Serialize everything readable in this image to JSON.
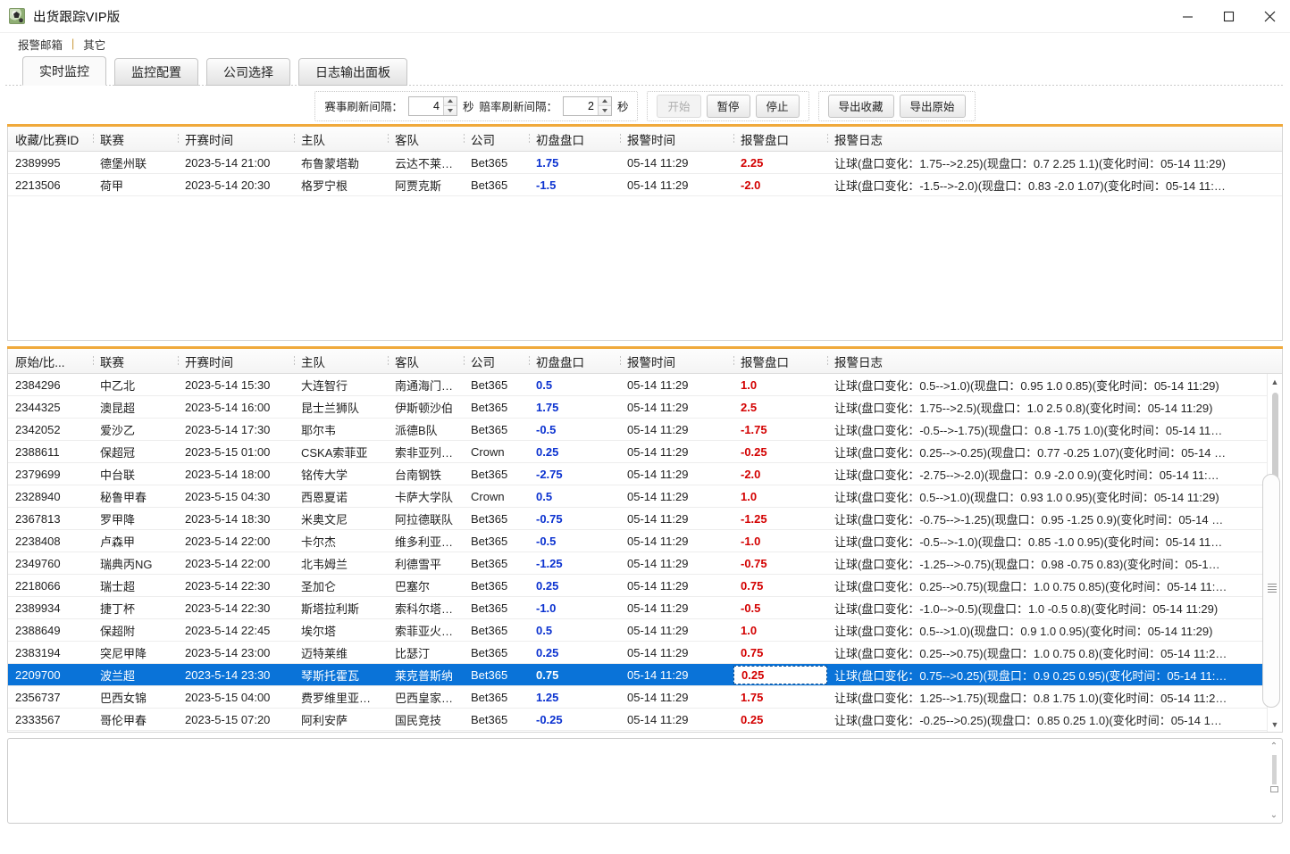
{
  "window": {
    "title": "出货跟踪VIP版",
    "icon": "soccer-ball-icon",
    "minimize": "−",
    "maximize": "□",
    "close": "✕"
  },
  "menubar": {
    "items": [
      "报警邮箱",
      "其它"
    ],
    "separator": "|"
  },
  "tabs": [
    {
      "label": "实时监控",
      "active": true
    },
    {
      "label": "监控配置",
      "active": false
    },
    {
      "label": "公司选择",
      "active": false
    },
    {
      "label": "日志输出面板",
      "active": false
    }
  ],
  "toolbar": {
    "match_interval_label": "赛事刷新间隔：",
    "match_interval_value": "4",
    "match_interval_unit": "秒",
    "odds_interval_label": "赔率刷新间隔：",
    "odds_interval_value": "2",
    "odds_interval_unit": "秒",
    "start_label": "开始",
    "start_disabled": true,
    "pause_label": "暂停",
    "stop_label": "停止",
    "export_fav_label": "导出收藏",
    "export_raw_label": "导出原始"
  },
  "accent_color": "#f0a93b",
  "top_grid": {
    "columns": [
      "收藏/比赛ID",
      "联赛",
      "开赛时间",
      "主队",
      "客队",
      "公司",
      "初盘盘口",
      "报警时间",
      "报警盘口",
      "报警日志"
    ],
    "rows": [
      {
        "id": "2389995",
        "league": "德堡州联",
        "start": "2023-5-14 21:00",
        "home": "布鲁蒙塔勒",
        "away": "云达不莱梅C队",
        "company": "Bet365",
        "open": "1.75",
        "alert_time": "05-14 11:29",
        "alert_odds": "2.25",
        "log": "让球(盘口变化：1.75-->2.25)(现盘口：0.7  2.25  1.1)(变化时间：05-14 11:29)"
      },
      {
        "id": "2213506",
        "league": "荷甲",
        "start": "2023-5-14 20:30",
        "home": "格罗宁根",
        "away": "阿贾克斯",
        "company": "Bet365",
        "open": "-1.5",
        "alert_time": "05-14 11:29",
        "alert_odds": "-2.0",
        "log": "让球(盘口变化：-1.5-->-2.0)(现盘口：0.83  -2.0  1.07)(变化时间：05-14 11:…"
      }
    ]
  },
  "bottom_grid": {
    "columns": [
      "原始/比...",
      "联赛",
      "开赛时间",
      "主队",
      "客队",
      "公司",
      "初盘盘口",
      "报警时间",
      "报警盘口",
      "报警日志"
    ],
    "rows": [
      {
        "id": "2384296",
        "league": "中乙北",
        "start": "2023-5-14 15:30",
        "home": "大连智行",
        "away": "南通海门圳缔…",
        "company": "Bet365",
        "open": "0.5",
        "alert_time": "05-14 11:29",
        "alert_odds": "1.0",
        "log": "让球(盘口变化：0.5-->1.0)(现盘口：0.95  1.0  0.85)(变化时间：05-14 11:29)",
        "selected": false
      },
      {
        "id": "2344325",
        "league": "澳昆超",
        "start": "2023-5-14 16:00",
        "home": "昆士兰狮队",
        "away": "伊斯顿沙伯",
        "company": "Bet365",
        "open": "1.75",
        "alert_time": "05-14 11:29",
        "alert_odds": "2.5",
        "log": "让球(盘口变化：1.75-->2.5)(现盘口：1.0  2.5  0.8)(变化时间：05-14 11:29)",
        "selected": false
      },
      {
        "id": "2342052",
        "league": "爱沙乙",
        "start": "2023-5-14 17:30",
        "home": "耶尔韦",
        "away": "派德B队",
        "company": "Bet365",
        "open": "-0.5",
        "alert_time": "05-14 11:29",
        "alert_odds": "-1.75",
        "log": "让球(盘口变化：-0.5-->-1.75)(现盘口：0.8  -1.75  1.0)(变化时间：05-14 11…",
        "selected": false
      },
      {
        "id": "2388611",
        "league": "保超冠",
        "start": "2023-5-15 01:00",
        "home": "CSKA索菲亚",
        "away": "索非亚列夫斯…",
        "company": "Crown",
        "open": "0.25",
        "alert_time": "05-14 11:29",
        "alert_odds": "-0.25",
        "log": "让球(盘口变化：0.25-->-0.25)(现盘口：0.77  -0.25  1.07)(变化时间：05-14 …",
        "selected": false
      },
      {
        "id": "2379699",
        "league": "中台联",
        "start": "2023-5-14 18:00",
        "home": "铭传大学",
        "away": "台南钢铁",
        "company": "Bet365",
        "open": "-2.75",
        "alert_time": "05-14 11:29",
        "alert_odds": "-2.0",
        "log": "让球(盘口变化：-2.75-->-2.0)(现盘口：0.9  -2.0  0.9)(变化时间：05-14 11:…",
        "selected": false
      },
      {
        "id": "2328940",
        "league": "秘鲁甲春",
        "start": "2023-5-15 04:30",
        "home": "西恩夏诺",
        "away": "卡萨大学队",
        "company": "Crown",
        "open": "0.5",
        "alert_time": "05-14 11:29",
        "alert_odds": "1.0",
        "log": "让球(盘口变化：0.5-->1.0)(现盘口：0.93  1.0  0.95)(变化时间：05-14 11:29)",
        "selected": false
      },
      {
        "id": "2367813",
        "league": "罗甲降",
        "start": "2023-5-14 18:30",
        "home": "米奥文尼",
        "away": "阿拉德联队",
        "company": "Bet365",
        "open": "-0.75",
        "alert_time": "05-14 11:29",
        "alert_odds": "-1.25",
        "log": "让球(盘口变化：-0.75-->-1.25)(现盘口：0.95  -1.25  0.9)(变化时间：05-14 …",
        "selected": false
      },
      {
        "id": "2238408",
        "league": "卢森甲",
        "start": "2023-5-14 22:00",
        "home": "卡尔杰",
        "away": "维多利亚路斯…",
        "company": "Bet365",
        "open": "-0.5",
        "alert_time": "05-14 11:29",
        "alert_odds": "-1.0",
        "log": "让球(盘口变化：-0.5-->-1.0)(现盘口：0.85  -1.0  0.95)(变化时间：05-14 11…",
        "selected": false
      },
      {
        "id": "2349760",
        "league": "瑞典丙NG",
        "start": "2023-5-14 22:00",
        "home": "北韦姆兰",
        "away": "利德雪平",
        "company": "Bet365",
        "open": "-1.25",
        "alert_time": "05-14 11:29",
        "alert_odds": "-0.75",
        "log": "让球(盘口变化：-1.25-->-0.75)(现盘口：0.98  -0.75  0.83)(变化时间：05-1…",
        "selected": false
      },
      {
        "id": "2218066",
        "league": "瑞士超",
        "start": "2023-5-14 22:30",
        "home": "圣加仑",
        "away": "巴塞尔",
        "company": "Bet365",
        "open": "0.25",
        "alert_time": "05-14 11:29",
        "alert_odds": "0.75",
        "log": "让球(盘口变化：0.25-->0.75)(现盘口：1.0  0.75  0.85)(变化时间：05-14 11:…",
        "selected": false
      },
      {
        "id": "2389934",
        "league": "捷丁杯",
        "start": "2023-5-14 22:30",
        "home": "斯塔拉利斯",
        "away": "索科尔塔索维…",
        "company": "Bet365",
        "open": "-1.0",
        "alert_time": "05-14 11:29",
        "alert_odds": "-0.5",
        "log": "让球(盘口变化：-1.0-->-0.5)(现盘口：1.0  -0.5  0.8)(变化时间：05-14 11:29)",
        "selected": false
      },
      {
        "id": "2388649",
        "league": "保超附",
        "start": "2023-5-14 22:45",
        "home": "埃尔塔",
        "away": "索菲亚火车头",
        "company": "Bet365",
        "open": "0.5",
        "alert_time": "05-14 11:29",
        "alert_odds": "1.0",
        "log": "让球(盘口变化：0.5-->1.0)(现盘口：0.9  1.0  0.95)(变化时间：05-14 11:29)",
        "selected": false
      },
      {
        "id": "2383194",
        "league": "突尼甲降",
        "start": "2023-5-14 23:00",
        "home": "迈特莱维",
        "away": "比瑟汀",
        "company": "Bet365",
        "open": "0.25",
        "alert_time": "05-14 11:29",
        "alert_odds": "0.75",
        "log": "让球(盘口变化：0.25-->0.75)(现盘口：1.0  0.75  0.8)(变化时间：05-14 11:2…",
        "selected": false
      },
      {
        "id": "2209700",
        "league": "波兰超",
        "start": "2023-5-14 23:30",
        "home": "琴斯托霍瓦",
        "away": "莱克普斯纳",
        "company": "Bet365",
        "open": "0.75",
        "alert_time": "05-14 11:29",
        "alert_odds": "0.25",
        "log": "让球(盘口变化：0.75-->0.25)(现盘口：0.9  0.25  0.95)(变化时间：05-14 11:…",
        "selected": true
      },
      {
        "id": "2356737",
        "league": "巴西女锦",
        "start": "2023-5-15 04:00",
        "home": "费罗维里亚女…",
        "away": "巴西皇家女足",
        "company": "Bet365",
        "open": "1.25",
        "alert_time": "05-14 11:29",
        "alert_odds": "1.75",
        "log": "让球(盘口变化：1.25-->1.75)(现盘口：0.8  1.75  1.0)(变化时间：05-14 11:2…",
        "selected": false
      },
      {
        "id": "2333567",
        "league": "哥伦甲春",
        "start": "2023-5-15 07:20",
        "home": "阿利安萨",
        "away": "国民竞技",
        "company": "Bet365",
        "open": "-0.25",
        "alert_time": "05-14 11:29",
        "alert_odds": "0.25",
        "log": "让球(盘口变化：-0.25-->0.25)(现盘口：0.85  0.25  1.0)(变化时间：05-14 1…",
        "selected": false
      }
    ]
  },
  "log_panel": {
    "content": ""
  }
}
